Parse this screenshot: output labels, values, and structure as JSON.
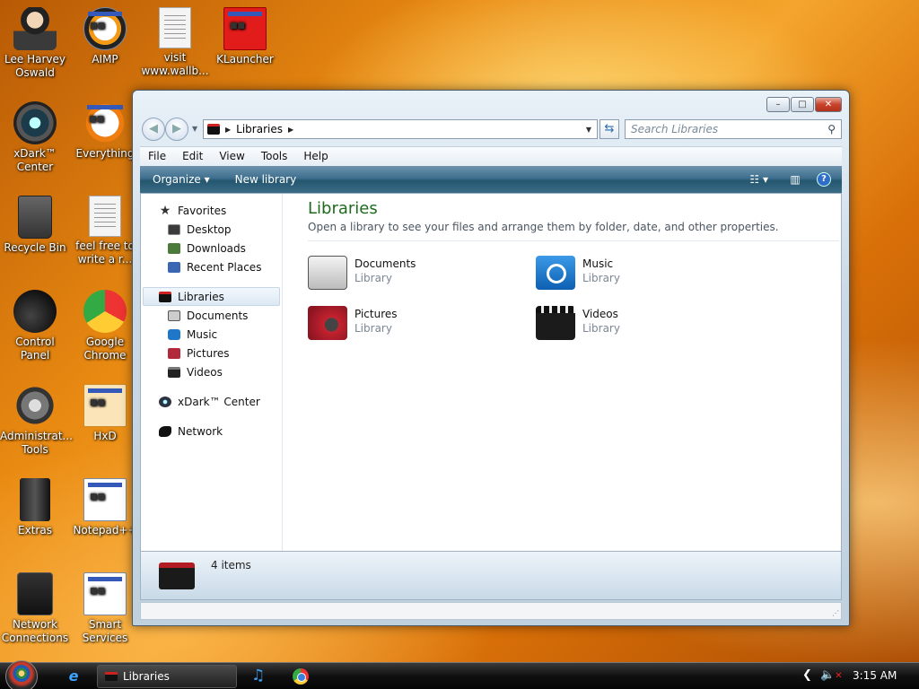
{
  "desktop": {
    "icons": [
      {
        "label": "Lee Harvey Oswald"
      },
      {
        "label": "AIMP"
      },
      {
        "label": "visit www.wallb..."
      },
      {
        "label": "KLauncher"
      },
      {
        "label": "xDark™ Center"
      },
      {
        "label": "Everything"
      },
      {
        "label": "Recycle Bin"
      },
      {
        "label": "feel free to write a r..."
      },
      {
        "label": "Control Panel"
      },
      {
        "label": "Google Chrome"
      },
      {
        "label": "Administrat... Tools"
      },
      {
        "label": "HxD"
      },
      {
        "label": "Extras"
      },
      {
        "label": "Notepad++"
      },
      {
        "label": "Network Connections"
      },
      {
        "label": "Smart Services"
      }
    ]
  },
  "window": {
    "controls": {
      "minimize": "–",
      "maximize": "□",
      "close": "✕"
    },
    "address": {
      "crumb": "Libraries"
    },
    "search": {
      "placeholder": "Search Libraries"
    },
    "menu": [
      "File",
      "Edit",
      "View",
      "Tools",
      "Help"
    ],
    "toolbar": {
      "organize": "Organize ▾",
      "new_library": "New library",
      "views": "▾",
      "help": "?"
    },
    "sidebar": {
      "favorites": {
        "label": "Favorites",
        "items": [
          "Desktop",
          "Downloads",
          "Recent Places"
        ]
      },
      "libraries": {
        "label": "Libraries",
        "items": [
          "Documents",
          "Music",
          "Pictures",
          "Videos"
        ]
      },
      "xdark": "xDark™ Center",
      "network": "Network"
    },
    "content": {
      "title": "Libraries",
      "subtitle": "Open a library to see your files and arrange them by folder, date, and other properties.",
      "libraries": [
        {
          "name": "Documents",
          "kind": "Library"
        },
        {
          "name": "Music",
          "kind": "Library"
        },
        {
          "name": "Pictures",
          "kind": "Library"
        },
        {
          "name": "Videos",
          "kind": "Library"
        }
      ]
    },
    "details": {
      "count": "4 items"
    }
  },
  "taskbar": {
    "task_label": "Libraries",
    "clock": "3:15 AM"
  }
}
